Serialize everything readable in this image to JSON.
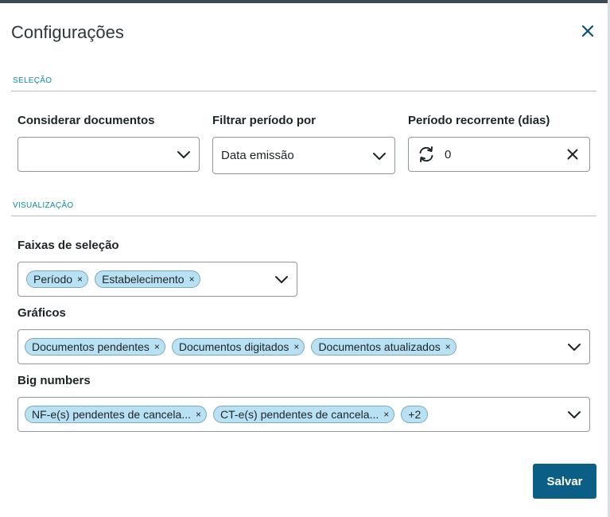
{
  "dialog": {
    "title": "Configurações"
  },
  "sections": {
    "selection": "SELEÇÃO",
    "visualization": "VISUALIZAÇÃO"
  },
  "fields": {
    "consider_documents": {
      "label": "Considerar documentos",
      "value": ""
    },
    "filter_period": {
      "label": "Filtrar período por",
      "value": "Data emissão"
    },
    "recurring_period": {
      "label": "Período recorrente (dias)",
      "value": "0"
    },
    "selection_ranges": {
      "label": "Faixas de seleção",
      "chips": [
        "Período",
        "Estabelecimento"
      ]
    },
    "charts": {
      "label": "Gráficos",
      "chips": [
        "Documentos pendentes",
        "Documentos digitados",
        "Documentos atualizados"
      ]
    },
    "big_numbers": {
      "label": "Big numbers",
      "chips": [
        "NF-e(s) pendentes de cancela...",
        "CT-e(s) pendentes de cancela..."
      ],
      "more": "+2"
    }
  },
  "chip_remove_glyph": "×",
  "actions": {
    "save_label": "Salvar"
  },
  "colors": {
    "accent": "#0c8da3",
    "primary_button": "#0b5f86",
    "chip_bg": "#b9e1f4",
    "chip_border": "#7ea9b8"
  }
}
